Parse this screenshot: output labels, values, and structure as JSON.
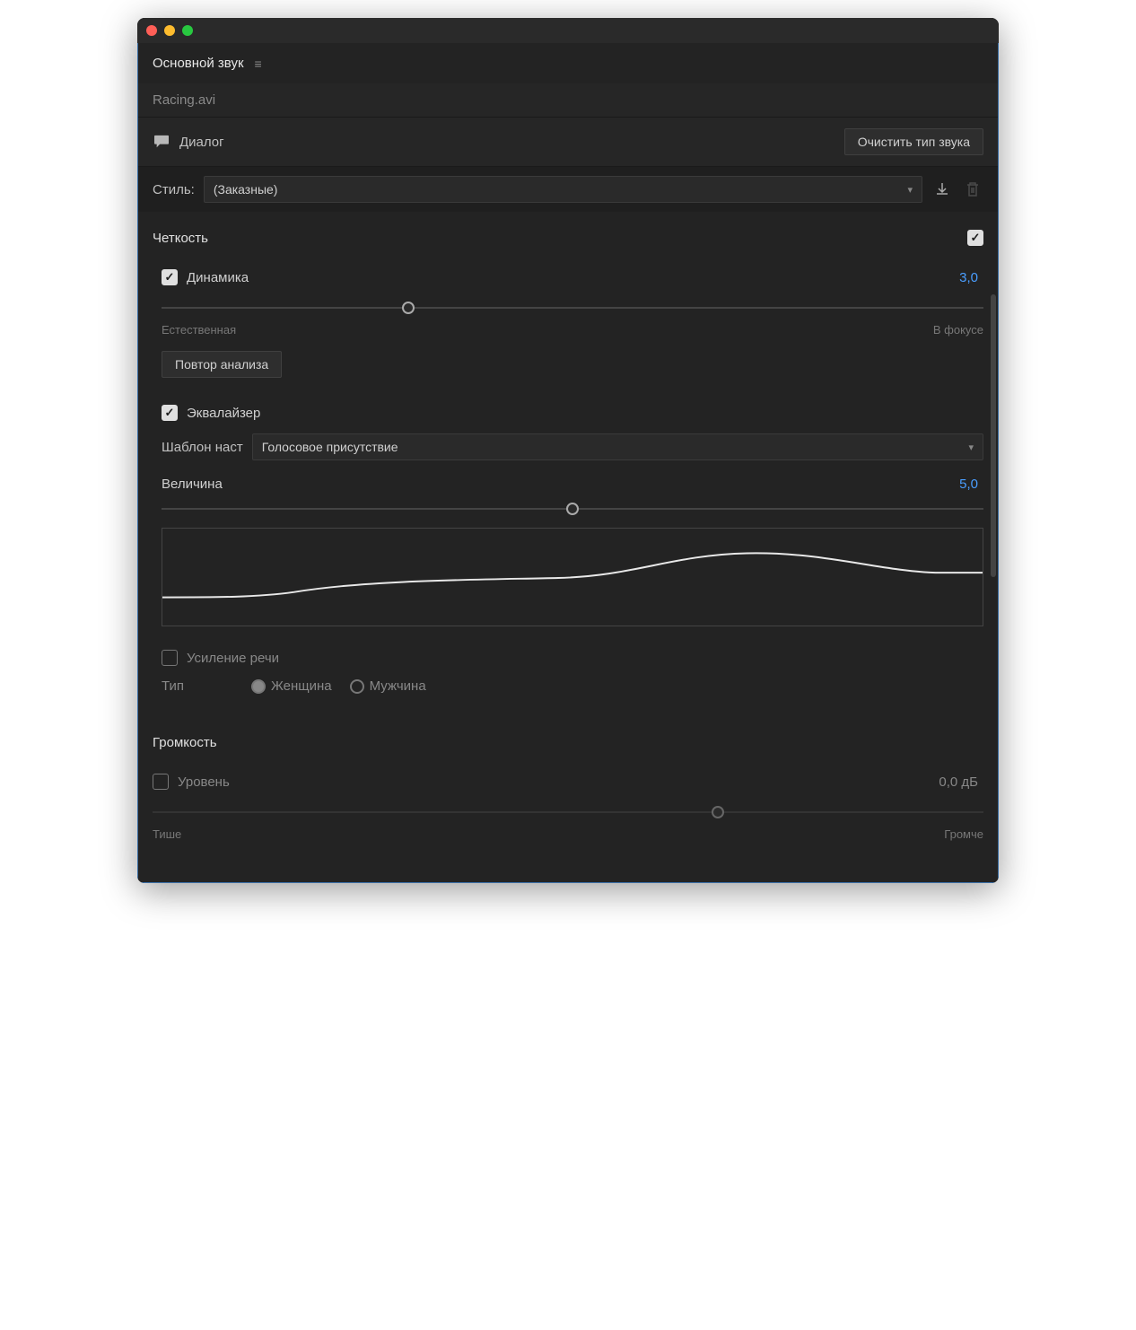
{
  "panelTitle": "Основной звук",
  "fileName": "Racing.avi",
  "audioType": {
    "label": "Диалог",
    "clearButton": "Очистить тип звука"
  },
  "style": {
    "label": "Стиль:",
    "value": "(Заказные)"
  },
  "clarity": {
    "title": "Четкость",
    "enabled": true,
    "dynamics": {
      "label": "Динамика",
      "value": "3,0",
      "sliderPercent": 30,
      "leftLabel": "Естественная",
      "rightLabel": "В фокусе",
      "reanalyzeButton": "Повтор анализа"
    },
    "equalizer": {
      "label": "Эквалайзер",
      "presetLabel": "Шаблон наст",
      "presetValue": "Голосовое присутствие",
      "amountLabel": "Величина",
      "amountValue": "5,0",
      "amountPercent": 50
    },
    "speechEnhance": {
      "label": "Усиление речи",
      "checked": false,
      "typeLabel": "Тип",
      "female": "Женщина",
      "male": "Мужчина"
    }
  },
  "volume": {
    "title": "Громкость",
    "level": {
      "label": "Уровень",
      "checked": false,
      "value": "0,0 дБ",
      "sliderPercent": 68,
      "leftLabel": "Тише",
      "rightLabel": "Громче"
    }
  }
}
